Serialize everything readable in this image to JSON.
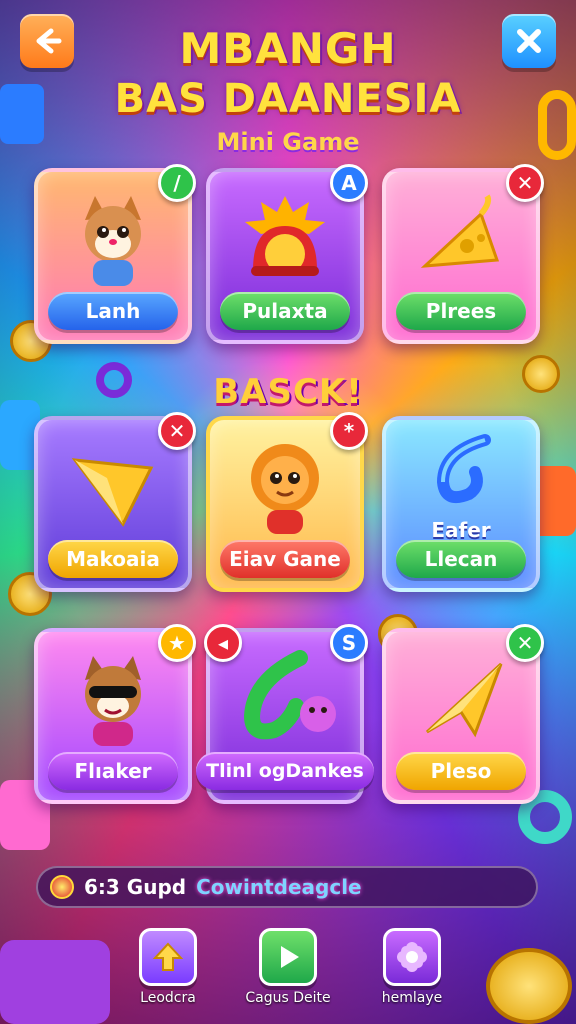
{
  "header": {
    "title_line1": "MBANGH",
    "title_line2": "BAS DAANESIA",
    "subtitle": "Mini Game"
  },
  "cards": [
    {
      "label": "Lanh",
      "badge": "/",
      "icon": "kitten-mascot-icon"
    },
    {
      "label": "Pulaxta",
      "badge": "A",
      "icon": "red-helmet-icon"
    },
    {
      "label": "Plrees",
      "badge": "✕",
      "icon": "cheese-wedge-icon"
    },
    {
      "label": "Makoaia",
      "badge": "✕",
      "icon": "gold-gem-icon"
    },
    {
      "label": "Eiav Gane",
      "badge": "*",
      "icon": "lion-cub-mascot-icon"
    },
    {
      "label": "Llecan",
      "badge": "",
      "icon": "blue-swirl-icon",
      "caption": "Eafer"
    },
    {
      "label": "Flıaker",
      "badge": "★",
      "icon": "cool-cat-mascot-icon"
    },
    {
      "label": "Tlinl ogDankes",
      "badge": "S",
      "badge2": "◂",
      "icon": "green-swoosh-icon"
    },
    {
      "label": "Pleso",
      "badge": "✕",
      "icon": "gold-arrow-icon"
    }
  ],
  "banner": "BASCK!",
  "status": {
    "text": "6:3 Gupd",
    "highlight": "Cowintdeagcle"
  },
  "nav": [
    {
      "label": "Leodcra",
      "icon": "up-arrow-icon"
    },
    {
      "label": "Cagus Deite",
      "icon": "play-icon"
    },
    {
      "label": "hemlaye",
      "icon": "flower-gear-icon"
    }
  ],
  "colors": {
    "title": "#ffe23d",
    "accent_pink": "#ff4fd8",
    "accent_cyan": "#19e0ff"
  }
}
